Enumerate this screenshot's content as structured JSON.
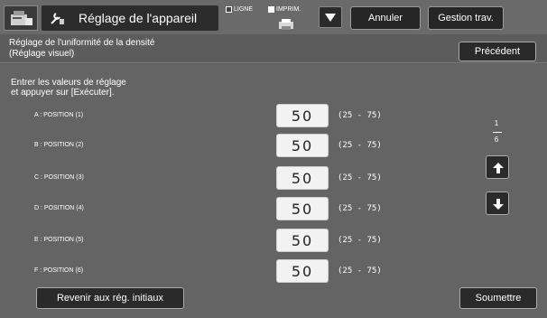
{
  "topbar": {
    "title": "Réglage de l'appareil",
    "mode_ligne": "LIGNE",
    "mode_imprim": "IMPRIM.",
    "cancel_label": "Annuler",
    "job_status_label": "Gestion trav."
  },
  "header": {
    "title_line1": "Réglage de l'uniformité de la densité",
    "title_line2": "(Réglage visuel)",
    "back_label": "Précédent"
  },
  "main": {
    "instruction_line1": "Entrer les valeurs de réglage",
    "instruction_line2": "et appuyer sur [Exécuter].",
    "rows": [
      {
        "label": "A : POSITION  (1)",
        "value": "50",
        "range": "(25 - 75)"
      },
      {
        "label": "B : POSITION  (2)",
        "value": "50",
        "range": "(25 - 75)"
      },
      {
        "label": "C : POSITION  (3)",
        "value": "50",
        "range": "(25 - 75)"
      },
      {
        "label": "D : POSITION  (4)",
        "value": "50",
        "range": "(25 - 75)"
      },
      {
        "label": "E : POSITION  (5)",
        "value": "50",
        "range": "(25 - 75)"
      },
      {
        "label": "F : POSITION  (6)",
        "value": "50",
        "range": "(25 - 75)"
      }
    ]
  },
  "pagination": {
    "current": "1",
    "total": "6"
  },
  "footer": {
    "reset_label": "Revenir aux rég. initiaux",
    "submit_label": "Soumettre"
  },
  "icons": {
    "app": "machine-settings-icon",
    "title": "wrench-icon",
    "printer": "printer-icon",
    "dropdown": "triangle-down-icon",
    "page_up": "arrow-up-icon",
    "page_down": "arrow-down-icon"
  }
}
